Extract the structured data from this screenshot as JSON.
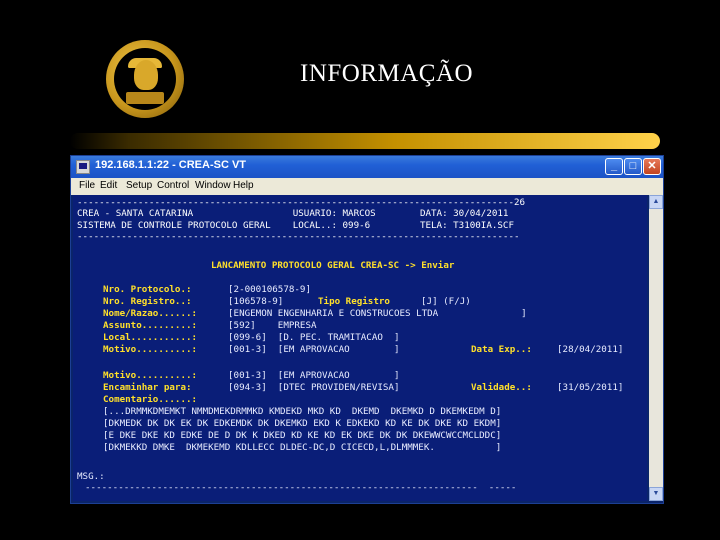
{
  "slide": {
    "title": "INFORMAÇÃO"
  },
  "window": {
    "title": "192.168.1.1:22 - CREA-SC VT",
    "buttons": {
      "minimize": "_",
      "maximize": "□",
      "close": "✕"
    },
    "menu": [
      "File",
      "Edit",
      "Setup",
      "Control",
      "Window",
      "Help"
    ]
  },
  "terminal": {
    "rule_top": "-------------------------------------------------------------------------------26",
    "hdr1": "CREA - SANTA CATARINA                  USUARIO: MARCOS        DATA: 30/04/2011",
    "hdr2": "SISTEMA DE CONTROLE PROTOCOLO GERAL    LOCAL..: 099-6         TELA: T3100IA.SCF",
    "rule_mid": "--------------------------------------------------------------------------------",
    "screen_title": "LANCAMENTO PROTOCOLO GERAL CREA-SC -> Enviar",
    "fields": {
      "protocolo_label": "Nro. Protocolo.:",
      "protocolo_value": "[2-000106578-9]",
      "registro_label": "Nro. Registro..:",
      "registro_value": "[106578-9]",
      "tipo_label": "Tipo Registro",
      "tipo_value": "[J] (F/J)",
      "nome_label": "Nome/Razao......:",
      "nome_value": "[ENGEMON ENGENHARIA E CONSTRUCOES LTDA               ]",
      "assunto_label": "Assunto.........:",
      "assunto_value": "[592]    EMPRESA",
      "local_label": "Local...........:",
      "local_value": "[099-6]  [D. PEC. TRAMITACAO  ]",
      "motivo1_label": "Motivo..........:",
      "motivo1_value": "[001-3]  [EM APROVACAO        ]",
      "dtexp_label": "Data Exp..:",
      "dtexp_value": "[28/04/2011]",
      "motivo2_label": "Motivo..........:",
      "motivo2_value": "[001-3]  [EM APROVACAO        ]",
      "encaminhar_label": "Encaminhar para:",
      "encaminhar_value": "[094-3]  [DTEC PROVIDEN/REVISA]",
      "validade_label": "Validade..:",
      "validade_value": "[31/05/2011]",
      "comentario_label": "Comentario......:"
    },
    "comments": [
      "[...DRMMKDMEMKT NMMDMEKDRMMKD KMDEKD MKD KD  DKEMD  DKEMKD D DKEMKEDM D]",
      "[DKMEDK DK DK EK DK EDKEMDK DK DKEMKD EKD K EDKEKD KD KE DK DKE KD EKDM]",
      "[E DKE DKE KD EDKE DE D DK K DKED KD KE KD EK DKE DK DK DKEWWCWCCMCLDDC]",
      "[DKMEKKD DMKE  DKMEKEMD KDLLECC DLDEC-DC,D CICECD,L,DLMMMEK.           ]"
    ],
    "msg": "MSG.:",
    "rule_bottom": "-----------------------------------------------------------------------  -----"
  }
}
